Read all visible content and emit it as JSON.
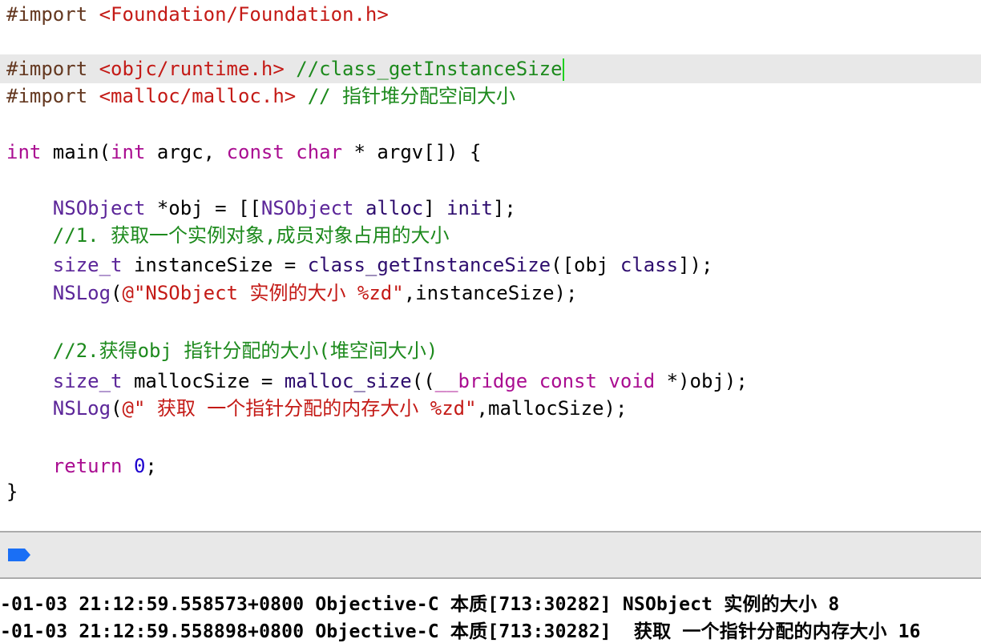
{
  "editor": {
    "highlighted_line": 3,
    "lines": [
      [
        [
          "#import ",
          "pre"
        ],
        [
          "<Foundation/Foundation.h>",
          "str"
        ]
      ],
      [],
      [
        [
          "#import ",
          "pre"
        ],
        [
          "<objc/runtime.h>",
          "str"
        ],
        [
          " ",
          "txt"
        ],
        [
          "//class_getInstanceSize",
          "com"
        ]
      ],
      [
        [
          "#import ",
          "pre"
        ],
        [
          "<malloc/malloc.h>",
          "str"
        ],
        [
          " ",
          "txt"
        ],
        [
          "// 指针堆分配空间大小",
          "com"
        ]
      ],
      [],
      [
        [
          "int",
          "kw"
        ],
        [
          " main(",
          "txt"
        ],
        [
          "int",
          "kw"
        ],
        [
          " argc, ",
          "txt"
        ],
        [
          "const",
          "kw"
        ],
        [
          " ",
          "txt"
        ],
        [
          "char",
          "kw"
        ],
        [
          " * argv[]) {",
          "txt"
        ]
      ],
      [],
      [
        [
          "    ",
          "txt"
        ],
        [
          "NSObject",
          "cls"
        ],
        [
          " *obj = [[",
          "txt"
        ],
        [
          "NSObject",
          "cls"
        ],
        [
          " ",
          "txt"
        ],
        [
          "alloc",
          "fn"
        ],
        [
          "] ",
          "txt"
        ],
        [
          "init",
          "fn"
        ],
        [
          "];",
          "txt"
        ]
      ],
      [
        [
          "    ",
          "txt"
        ],
        [
          "//1. 获取一个实例对象,成员对象占用的大小",
          "com"
        ]
      ],
      [
        [
          "    ",
          "txt"
        ],
        [
          "size_t",
          "cls"
        ],
        [
          " instanceSize = ",
          "txt"
        ],
        [
          "class_getInstanceSize",
          "fn"
        ],
        [
          "([obj ",
          "txt"
        ],
        [
          "class",
          "fn"
        ],
        [
          "]);",
          "txt"
        ]
      ],
      [
        [
          "    ",
          "txt"
        ],
        [
          "NSLog",
          "cls"
        ],
        [
          "(",
          "txt"
        ],
        [
          "@\"NSObject 实例的大小 %zd\"",
          "str"
        ],
        [
          ",instanceSize);",
          "txt"
        ]
      ],
      [],
      [
        [
          "    ",
          "txt"
        ],
        [
          "//2.获得obj 指针分配的大小(堆空间大小)",
          "com"
        ]
      ],
      [
        [
          "    ",
          "txt"
        ],
        [
          "size_t",
          "cls"
        ],
        [
          " mallocSize = ",
          "txt"
        ],
        [
          "malloc_size",
          "fn"
        ],
        [
          "((",
          "txt"
        ],
        [
          "__bridge",
          "kw"
        ],
        [
          " ",
          "txt"
        ],
        [
          "const",
          "kw"
        ],
        [
          " ",
          "txt"
        ],
        [
          "void",
          "kw"
        ],
        [
          " *)obj);",
          "txt"
        ]
      ],
      [
        [
          "    ",
          "txt"
        ],
        [
          "NSLog",
          "cls"
        ],
        [
          "(",
          "txt"
        ],
        [
          "@\" 获取 一个指针分配的内存大小 %zd\"",
          "str"
        ],
        [
          ",mallocSize);",
          "txt"
        ]
      ],
      [],
      [
        [
          "    ",
          "txt"
        ],
        [
          "return",
          "kw"
        ],
        [
          " ",
          "txt"
        ],
        [
          "0",
          "num"
        ],
        [
          ";",
          "txt"
        ]
      ],
      [
        [
          "}",
          "txt"
        ]
      ]
    ]
  },
  "console": {
    "run_icon": "breakpoint-continue-icon",
    "logs": [
      "-01-03 21:12:59.558573+0800 Objective-C 本质[713:30282] NSObject 实例的大小 8",
      "-01-03 21:12:59.558898+0800 Objective-C 本质[713:30282]  获取 一个指针分配的内存大小 16"
    ]
  }
}
